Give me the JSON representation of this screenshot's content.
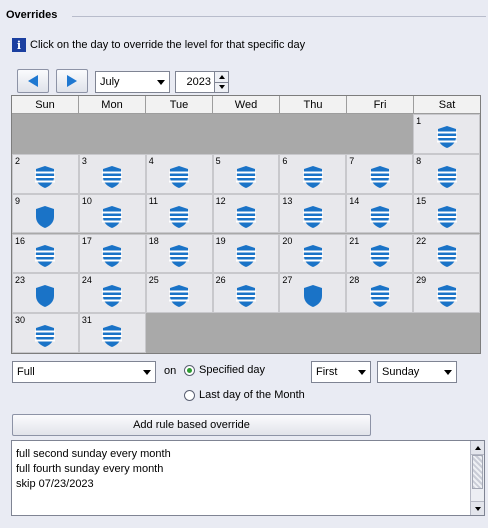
{
  "section": {
    "title": "Overrides"
  },
  "info": {
    "text": "Click on the day to override the level for that specific day"
  },
  "nav": {
    "month": "July",
    "year": "2023"
  },
  "calendar": {
    "days_of_week": [
      "Sun",
      "Mon",
      "Tue",
      "Wed",
      "Thu",
      "Fri",
      "Sat"
    ],
    "first_weekday": 6,
    "days": [
      {
        "n": "1",
        "icon": "striped"
      },
      {
        "n": "2",
        "icon": "striped"
      },
      {
        "n": "3",
        "icon": "striped"
      },
      {
        "n": "4",
        "icon": "striped"
      },
      {
        "n": "5",
        "icon": "striped"
      },
      {
        "n": "6",
        "icon": "striped"
      },
      {
        "n": "7",
        "icon": "striped"
      },
      {
        "n": "8",
        "icon": "striped"
      },
      {
        "n": "9",
        "icon": "solid"
      },
      {
        "n": "10",
        "icon": "striped"
      },
      {
        "n": "11",
        "icon": "striped"
      },
      {
        "n": "12",
        "icon": "striped"
      },
      {
        "n": "13",
        "icon": "striped"
      },
      {
        "n": "14",
        "icon": "striped"
      },
      {
        "n": "15",
        "icon": "striped"
      },
      {
        "n": "16",
        "icon": "striped"
      },
      {
        "n": "17",
        "icon": "striped"
      },
      {
        "n": "18",
        "icon": "striped"
      },
      {
        "n": "19",
        "icon": "striped"
      },
      {
        "n": "20",
        "icon": "striped"
      },
      {
        "n": "21",
        "icon": "striped"
      },
      {
        "n": "22",
        "icon": "striped"
      },
      {
        "n": "23",
        "icon": "solid"
      },
      {
        "n": "24",
        "icon": "striped"
      },
      {
        "n": "25",
        "icon": "striped"
      },
      {
        "n": "26",
        "icon": "striped"
      },
      {
        "n": "27",
        "icon": "solid"
      },
      {
        "n": "28",
        "icon": "striped"
      },
      {
        "n": "29",
        "icon": "striped"
      },
      {
        "n": "30",
        "icon": "striped"
      },
      {
        "n": "31",
        "icon": "striped"
      }
    ]
  },
  "rule": {
    "level": "Full",
    "on_label": "on",
    "specified_day_label": "Specified day",
    "last_day_label": "Last day of the Month",
    "ordinal": "First",
    "weekday": "Sunday",
    "add_button": "Add rule based override"
  },
  "rules_list": [
    "full second sunday every month",
    "full fourth sunday every month",
    "skip 07/23/2023"
  ],
  "colors": {
    "accent": "#1a73c7",
    "stripe": "#ffffff",
    "selected_radio": "#2d9c32"
  }
}
